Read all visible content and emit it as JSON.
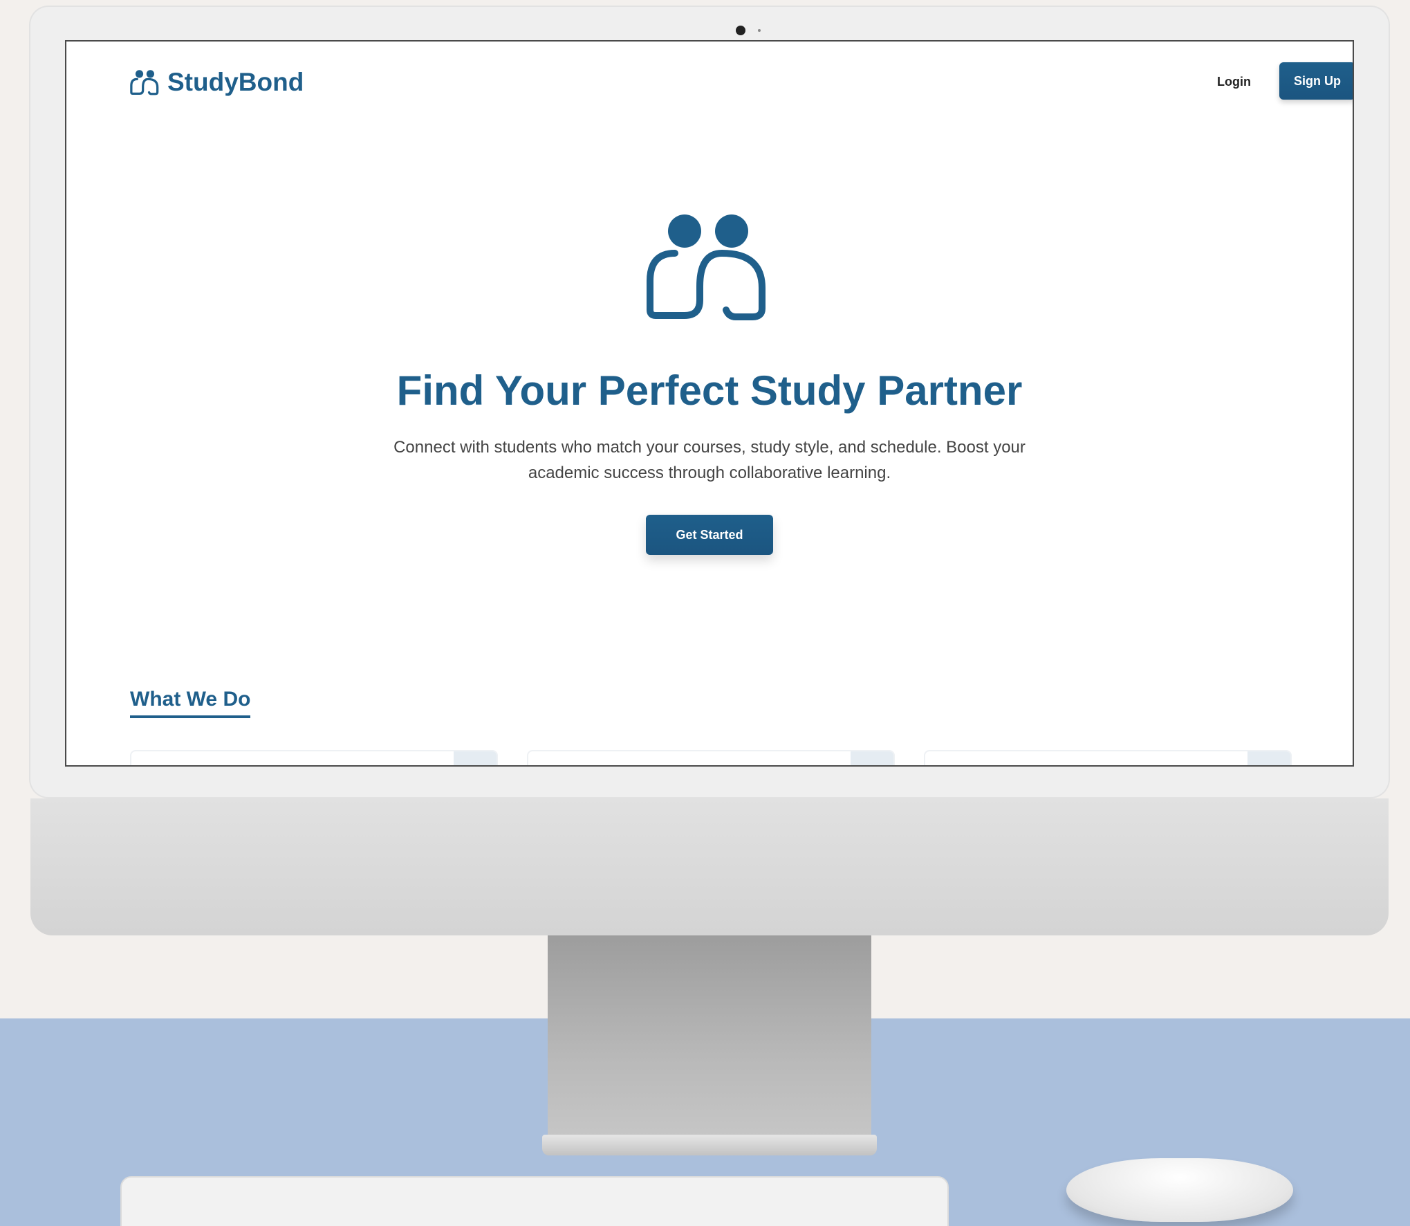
{
  "brand": {
    "name": "StudyBond",
    "color": "#1f5f8b"
  },
  "nav": {
    "login_label": "Login",
    "signup_label": "Sign Up"
  },
  "hero": {
    "icon": "two-people-icon",
    "title": "Find Your Perfect Study Partner",
    "subtitle": "Connect with students who match your courses, study style, and schedule. Boost your academic success through collaborative learning.",
    "cta_label": "Get Started"
  },
  "section": {
    "title": "What We Do"
  },
  "colors": {
    "accent": "#1f5f8b",
    "desk": "#aabfdc",
    "background": "#f3f0ed"
  }
}
